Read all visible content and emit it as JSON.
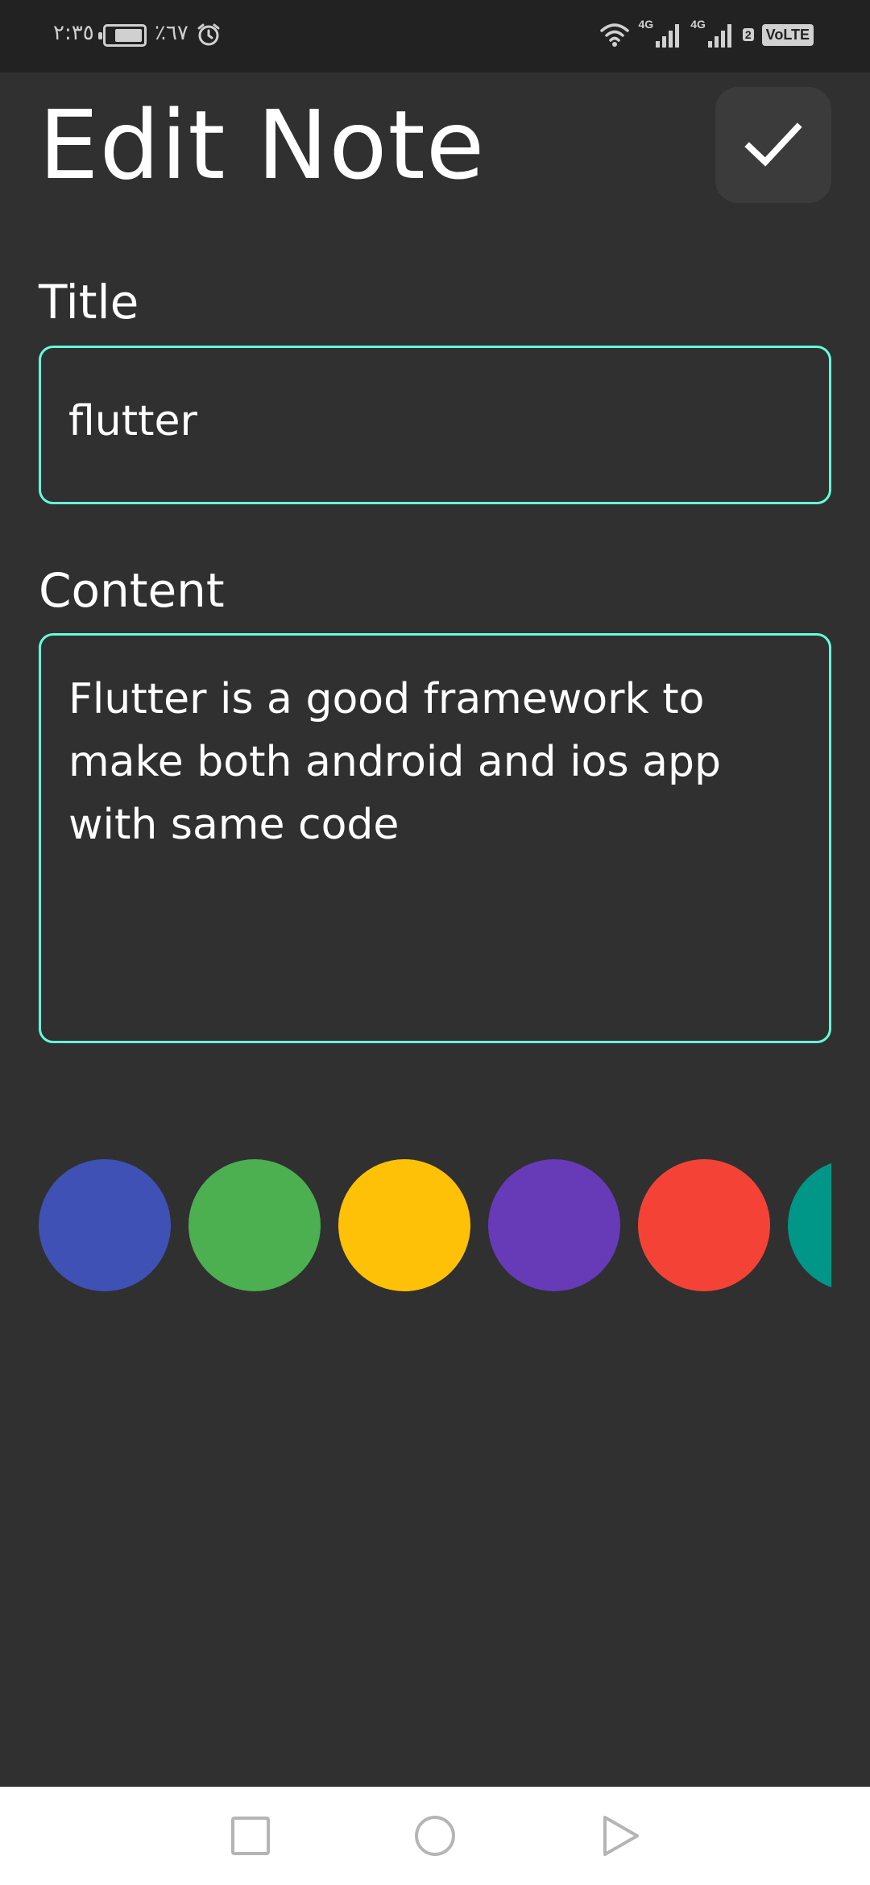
{
  "status_bar": {
    "time": "٢:٣٥",
    "battery": "٪٦٧",
    "network_1": "4G",
    "network_2": "4G",
    "sim_badge": "2",
    "volte": "VoLTE"
  },
  "header": {
    "title": "Edit Note",
    "save_icon": "check-icon"
  },
  "form": {
    "title_label": "Title",
    "title_value": "flutter",
    "content_label": "Content",
    "content_value": "Flutter is a good framework to\nmake both android and ios app\nwith same code"
  },
  "colors": [
    "#3f51b5",
    "#4caf50",
    "#ffc107",
    "#673ab7",
    "#f44336",
    "#009688"
  ],
  "nav": {
    "recents_icon": "square-icon",
    "home_icon": "circle-icon",
    "back_icon": "triangle-back-icon"
  },
  "theme": {
    "background": "#303030",
    "accent_border": "#64ffda",
    "button_bg": "#3b3b3b"
  }
}
